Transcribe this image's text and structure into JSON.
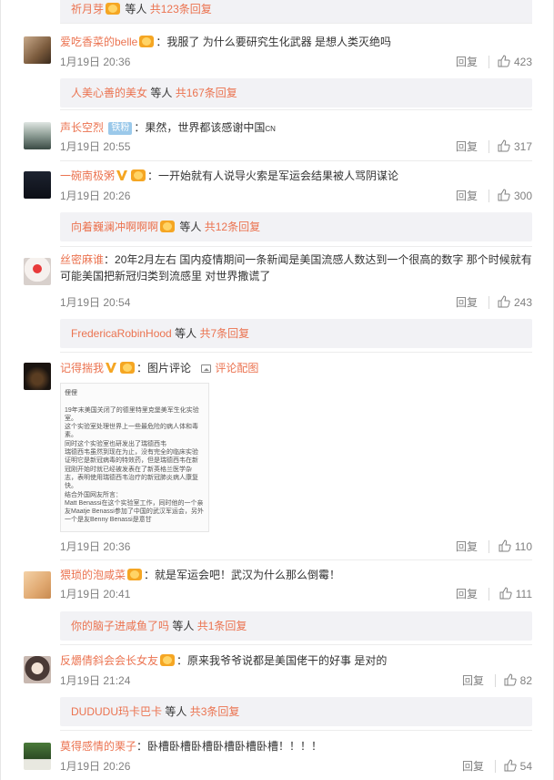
{
  "ui": {
    "reply_label": "回复",
    "image_comment_label": "评论配图",
    "others_label": "等人",
    "fan_badge": "铁粉",
    "cn_tag": "CN"
  },
  "top_subreply": {
    "name": "祈月芽",
    "count": "共123条回复"
  },
  "comments": [
    {
      "user": "爱吃香菜的belle",
      "content": "：我服了 为什么要研究生化武器 是想人类灭绝吗",
      "time": "1月19日 20:36",
      "likes": "423",
      "subreply": {
        "name": "人美心善的美女",
        "count": "共167条回复"
      }
    },
    {
      "user": "声长空烈",
      "content": "：果然，世界都该感谢中国",
      "time": "1月19日 20:55",
      "likes": "317"
    },
    {
      "user": "一碗南极粥",
      "content": "：一开始就有人说导火索是军运会结果被人骂阴谋论",
      "time": "1月19日 20:26",
      "likes": "300",
      "subreply": {
        "name": "向着巍澜冲啊啊啊",
        "count": "共12条回复"
      }
    },
    {
      "user": "丝密麻谁",
      "content": "：20年2月左右 国内疫情期间一条新闻是美国流感人数达到一个很高的数字 那个时候就有可能美国把新冠归类到流感里 对世界撒谎了",
      "time": "1月19日 20:54",
      "likes": "243",
      "subreply": {
        "name": "FredericaRobinHood",
        "count": "共7条回复"
      }
    },
    {
      "user": "记得揣我",
      "content": "：图片评论",
      "time": "1月19日 20:36",
      "likes": "110",
      "image_text": "俚俚\n\n19年末美国关闭了的德里特里克堡美军生化实验室。\n这个实验室处理世界上一些最危险的病人体和毒素。\n同时这个实验室也研发出了瑞德西韦\n瑞德西韦虽然到现在为止，没有完全的临床实验证明它是新冠病毒的特效药，但是瑞德西韦在新冠刚开始时就已经被发表在了新英格兰医学杂志，表明使用瑞德西韦治疗的新冠肺炎病人康复快。\n结合外国网友所言：\nMatt Benassi在这个实验室工作，同时他的一个亲友Maatje Benassi参加了中国的武汉军运会，另外一个是友Benny Benassi是意甘"
    },
    {
      "user": "猥琐的泡咸菜",
      "content": "：就是军运会吧！武汉为什么那么倒霉！",
      "time": "1月19日 20:41",
      "likes": "111",
      "subreply": {
        "name": "你的脑子进咸鱼了吗",
        "count": "共1条回复"
      }
    },
    {
      "user": "反爝倩斜会会长女友",
      "content": "：原来我爷爷说都是美国佬干的好事 是对的",
      "time": "1月19日 21:24",
      "likes": "82",
      "subreply": {
        "name": "DUDUDU玛卡巴卡",
        "count": "共3条回复"
      }
    },
    {
      "user": "莫得感情的栗子",
      "content": "：卧槽卧槽卧槽卧槽卧槽卧槽！！！！",
      "time": "1月19日 20:26",
      "likes": "54"
    }
  ],
  "colors": {
    "username": "#eb7350",
    "meta": "#808080",
    "subreply_bg": "#f2f2f5",
    "fan_badge": "#9bc9ea"
  }
}
